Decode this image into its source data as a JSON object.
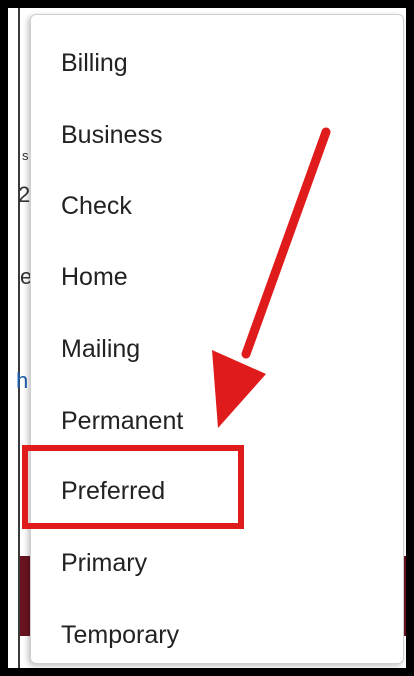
{
  "dropdown": {
    "options": [
      "Billing",
      "Business",
      "Check",
      "Home",
      "Mailing",
      "Permanent",
      "Preferred",
      "Primary",
      "Temporary"
    ],
    "highlighted_option": "Preferred"
  },
  "background": {
    "fragments": [
      "s",
      "2",
      "e",
      "h"
    ]
  },
  "colors": {
    "annotation": "#e01b1b",
    "page_accent": "#6a1420",
    "link": "#1f5fae"
  }
}
